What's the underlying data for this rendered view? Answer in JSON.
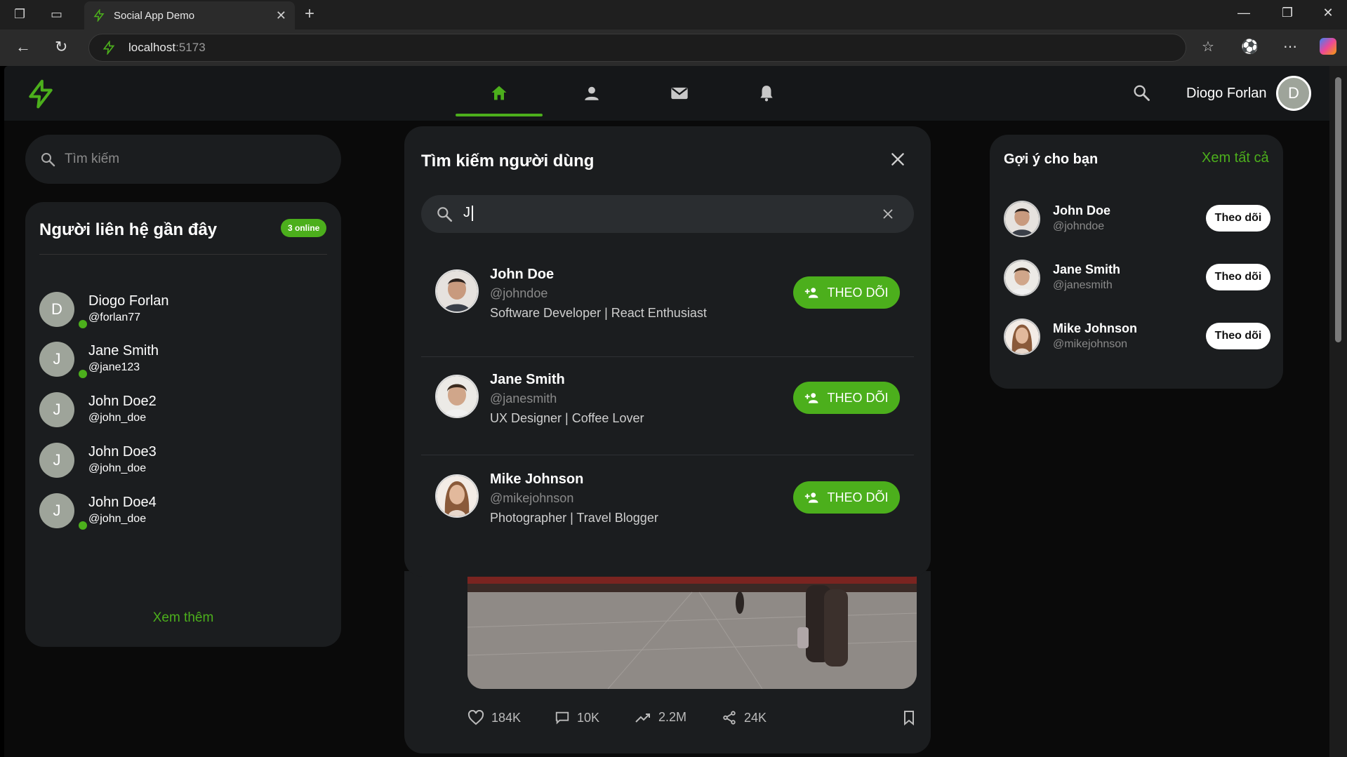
{
  "browser": {
    "tab_title": "Social App Demo",
    "url_host": "localhost",
    "url_port": ":5173"
  },
  "header": {
    "user_name": "Diogo Forlan",
    "avatar_letter": "D",
    "nav": [
      "home",
      "profile",
      "messages",
      "notifications"
    ],
    "accent": "#4caf1c"
  },
  "left": {
    "search_placeholder": "Tìm kiếm",
    "contacts_title": "Người liên hệ gần đây",
    "online_badge": "3 online",
    "contacts": [
      {
        "letter": "D",
        "name": "Diogo Forlan",
        "handle": "@forlan77"
      },
      {
        "letter": "J",
        "name": "Jane Smith",
        "handle": "@jane123"
      },
      {
        "letter": "J",
        "name": "John Doe2",
        "handle": "@john_doe"
      },
      {
        "letter": "J",
        "name": "John Doe3",
        "handle": "@john_doe"
      },
      {
        "letter": "J",
        "name": "John Doe4",
        "handle": "@john_doe"
      }
    ],
    "see_more": "Xem thêm"
  },
  "modal": {
    "title": "Tìm kiếm người dùng",
    "query": "J",
    "follow_label": "THEO DÕI",
    "results": [
      {
        "name": "John Doe",
        "handle": "@johndoe",
        "bio": "Software Developer | React Enthusiast"
      },
      {
        "name": "Jane Smith",
        "handle": "@janesmith",
        "bio": "UX Designer | Coffee Lover"
      },
      {
        "name": "Mike Johnson",
        "handle": "@mikejohnson",
        "bio": "Photographer | Travel Blogger"
      }
    ]
  },
  "post": {
    "likes": "184K",
    "comments": "10K",
    "views": "2.2M",
    "shares": "24K"
  },
  "suggest": {
    "title": "Gợi ý cho bạn",
    "see_all": "Xem tất cả",
    "follow_label": "Theo dõi",
    "items": [
      {
        "name": "John Doe",
        "handle": "@johndoe"
      },
      {
        "name": "Jane Smith",
        "handle": "@janesmith"
      },
      {
        "name": "Mike Johnson",
        "handle": "@mikejohnson"
      }
    ]
  }
}
